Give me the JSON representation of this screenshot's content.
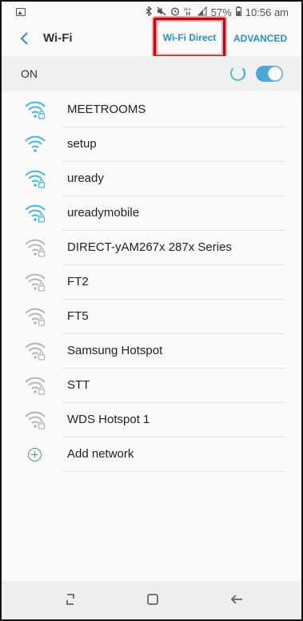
{
  "status_bar": {
    "battery_percent": "57%",
    "time": "10:56 am",
    "icons": [
      "image-icon",
      "bluetooth-icon",
      "mute-icon",
      "alarm-icon",
      "hd-signal-icon",
      "signal-icon",
      "battery-icon"
    ]
  },
  "header": {
    "title": "Wi-Fi",
    "wifi_direct": "Wi-Fi Direct",
    "advanced": "ADVANCED"
  },
  "toggle_row": {
    "label": "ON",
    "state": true
  },
  "networks": [
    {
      "name": "MEETROOMS",
      "secured": true,
      "strength": "strong"
    },
    {
      "name": "setup",
      "secured": false,
      "strength": "strong"
    },
    {
      "name": "uready",
      "secured": true,
      "strength": "strong"
    },
    {
      "name": "ureadymobile",
      "secured": true,
      "strength": "strong"
    },
    {
      "name": "DIRECT-yAM267x 287x Series",
      "secured": true,
      "strength": "weak"
    },
    {
      "name": "FT2",
      "secured": true,
      "strength": "weak"
    },
    {
      "name": "FT5",
      "secured": true,
      "strength": "weak"
    },
    {
      "name": "Samsung Hotspot",
      "secured": true,
      "strength": "weak"
    },
    {
      "name": "STT",
      "secured": true,
      "strength": "weak"
    },
    {
      "name": "WDS Hotspot 1",
      "secured": true,
      "strength": "weak"
    }
  ],
  "add_network": "Add network",
  "colors": {
    "accent": "#2b8fc4",
    "highlight": "#c7000b",
    "wifi_strong": "#47b7da",
    "wifi_weak": "#b5b5b5"
  }
}
